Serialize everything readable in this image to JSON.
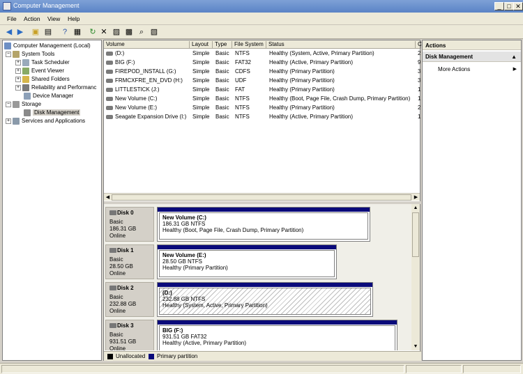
{
  "window": {
    "title": "Computer Management"
  },
  "menu": [
    "File",
    "Action",
    "View",
    "Help"
  ],
  "tree": {
    "root": "Computer Management (Local)",
    "system_tools": "System Tools",
    "task_scheduler": "Task Scheduler",
    "event_viewer": "Event Viewer",
    "shared_folders": "Shared Folders",
    "reliability": "Reliability and Performanc",
    "device_manager": "Device Manager",
    "storage": "Storage",
    "disk_management": "Disk Management",
    "services": "Services and Applications"
  },
  "volumes": {
    "headers": [
      "Volume",
      "Layout",
      "Type",
      "File System",
      "Status",
      "C"
    ],
    "rows": [
      {
        "volume": "(D:)",
        "layout": "Simple",
        "type": "Basic",
        "fs": "NTFS",
        "status": "Healthy (System, Active, Primary Partition)",
        "c": "2"
      },
      {
        "volume": "BIG (F:)",
        "layout": "Simple",
        "type": "Basic",
        "fs": "FAT32",
        "status": "Healthy (Active, Primary Partition)",
        "c": "9"
      },
      {
        "volume": "FIREPOD_INSTALL (G:)",
        "layout": "Simple",
        "type": "Basic",
        "fs": "CDFS",
        "status": "Healthy (Primary Partition)",
        "c": "3"
      },
      {
        "volume": "FRMCXFRE_EN_DVD (H:)",
        "layout": "Simple",
        "type": "Basic",
        "fs": "UDF",
        "status": "Healthy (Primary Partition)",
        "c": "3"
      },
      {
        "volume": "LITTLESTICK (J:)",
        "layout": "Simple",
        "type": "Basic",
        "fs": "FAT",
        "status": "Healthy (Primary Partition)",
        "c": "1"
      },
      {
        "volume": "New Volume (C:)",
        "layout": "Simple",
        "type": "Basic",
        "fs": "NTFS",
        "status": "Healthy (Boot, Page File, Crash Dump, Primary Partition)",
        "c": "1"
      },
      {
        "volume": "New Volume (E:)",
        "layout": "Simple",
        "type": "Basic",
        "fs": "NTFS",
        "status": "Healthy (Primary Partition)",
        "c": "2"
      },
      {
        "volume": "Seagate Expansion Drive (I:)",
        "layout": "Simple",
        "type": "Basic",
        "fs": "NTFS",
        "status": "Healthy (Active, Primary Partition)",
        "c": "1"
      }
    ]
  },
  "disks": [
    {
      "name": "Disk 0",
      "type": "Basic",
      "size": "186.31 GB",
      "state": "Online",
      "vol": "New Volume  (C:)",
      "detail": "186.31 GB NTFS",
      "status": "Healthy (Boot, Page File, Crash Dump, Primary Partition)"
    },
    {
      "name": "Disk 1",
      "type": "Basic",
      "size": "28.50 GB",
      "state": "Online",
      "vol": "New Volume  (E:)",
      "detail": "28.50 GB NTFS",
      "status": "Healthy (Primary Partition)"
    },
    {
      "name": "Disk 2",
      "type": "Basic",
      "size": "232.88 GB",
      "state": "Online",
      "vol": "(D:)",
      "detail": "232.88 GB NTFS",
      "status": "Healthy (System, Active, Primary Partition)"
    },
    {
      "name": "Disk 3",
      "type": "Basic",
      "size": "931.51 GB",
      "state": "Online",
      "vol": "BIG  (F:)",
      "detail": "931.51 GB FAT32",
      "status": "Healthy (Active, Primary Partition)"
    }
  ],
  "legend": {
    "unallocated": "Unallocated",
    "primary": "Primary partition"
  },
  "actions": {
    "title": "Actions",
    "section": "Disk Management",
    "more": "More Actions"
  },
  "colors": {
    "primary_partition": "#0a0a7a",
    "unallocated": "#000000",
    "title_bar": "#6a8fcc"
  }
}
